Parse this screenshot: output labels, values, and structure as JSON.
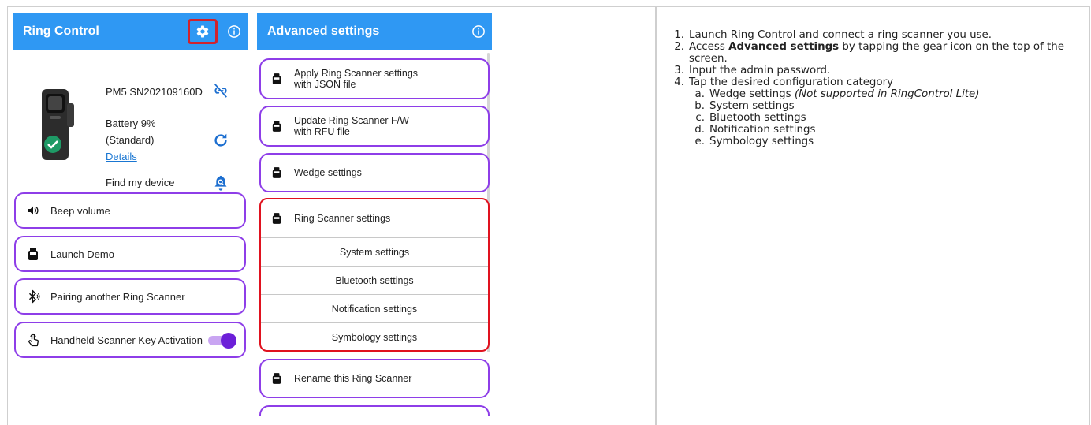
{
  "screen1": {
    "appbar": {
      "title": "Ring Control",
      "gear_icon": "gear-icon",
      "info_icon": "info-icon",
      "bg": "#2f98f3"
    },
    "device": {
      "model_serial": "PM5 SN202109160D",
      "battery": "Battery 9%",
      "battery_mode": "(Standard)",
      "details_link": "Details",
      "find_label": "Find my device"
    },
    "menu": {
      "beep": "Beep volume",
      "demo": "Launch Demo",
      "pairing": "Pairing another Ring Scanner",
      "handheld": "Handheld Scanner Key Activation"
    },
    "accent": "#8e3ee8",
    "highlight": "#d0222d"
  },
  "screen2": {
    "appbar": {
      "title": "Advanced settings",
      "info_icon": "info-icon"
    },
    "cards": {
      "apply_json_l1": "Apply Ring Scanner settings",
      "apply_json_l2": "with JSON file",
      "update_fw_l1": "Update Ring Scanner F/W",
      "update_fw_l2": "with RFU file",
      "wedge": "Wedge settings",
      "rename": "Rename this Ring Scanner"
    },
    "ring_group": {
      "title": "Ring Scanner settings",
      "items": [
        "System settings",
        "Bluetooth settings",
        "Notification settings",
        "Symbology settings"
      ]
    }
  },
  "instructions": {
    "step1_num": "1.",
    "step1": "Launch Ring Control and connect a ring scanner you use.",
    "step2_num": "2.",
    "step2_pre": "Access ",
    "step2_bold": "Advanced settings",
    "step2_post": " by tapping the gear icon on the top of the screen.",
    "step3_num": "3.",
    "step3": "Input the admin password.",
    "step4_num": "4.",
    "step4": "Tap the desired configuration category",
    "subs": [
      {
        "num": "a.",
        "text": "Wedge settings ",
        "note": "(Not supported in RingControl Lite)"
      },
      {
        "num": "b.",
        "text": "System settings",
        "note": ""
      },
      {
        "num": "c.",
        "text": "Bluetooth settings",
        "note": ""
      },
      {
        "num": "d.",
        "text": "Notification settings",
        "note": ""
      },
      {
        "num": "e.",
        "text": "Symbology settings",
        "note": ""
      }
    ]
  }
}
